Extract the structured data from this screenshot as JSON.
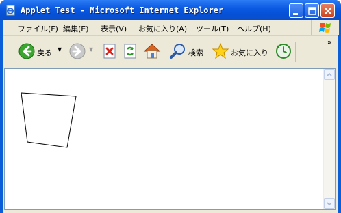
{
  "window": {
    "title": "Applet Test - Microsoft Internet Explorer"
  },
  "menu": {
    "items": [
      {
        "label": "ファイル(F)"
      },
      {
        "label": "編集(E)"
      },
      {
        "label": "表示(V)"
      },
      {
        "label": "お気に入り(A)"
      },
      {
        "label": "ツール(T)"
      },
      {
        "label": "ヘルプ(H)"
      }
    ]
  },
  "toolbar": {
    "back_label": "戻る",
    "search_label": "検索",
    "favorites_label": "お気に入り",
    "overflow_label": "»"
  },
  "colors": {
    "titlebar": "#0a5fd8",
    "frame": "#ece9d8",
    "content_bg": "#ffffff",
    "close_button": "#c8431f"
  },
  "icons": [
    "ie-page-icon",
    "minimize-icon",
    "maximize-icon",
    "close-icon",
    "windows-logo-icon",
    "back-arrow-icon",
    "forward-arrow-icon",
    "stop-icon",
    "refresh-icon",
    "home-icon",
    "search-icon",
    "favorites-star-icon",
    "history-icon"
  ]
}
